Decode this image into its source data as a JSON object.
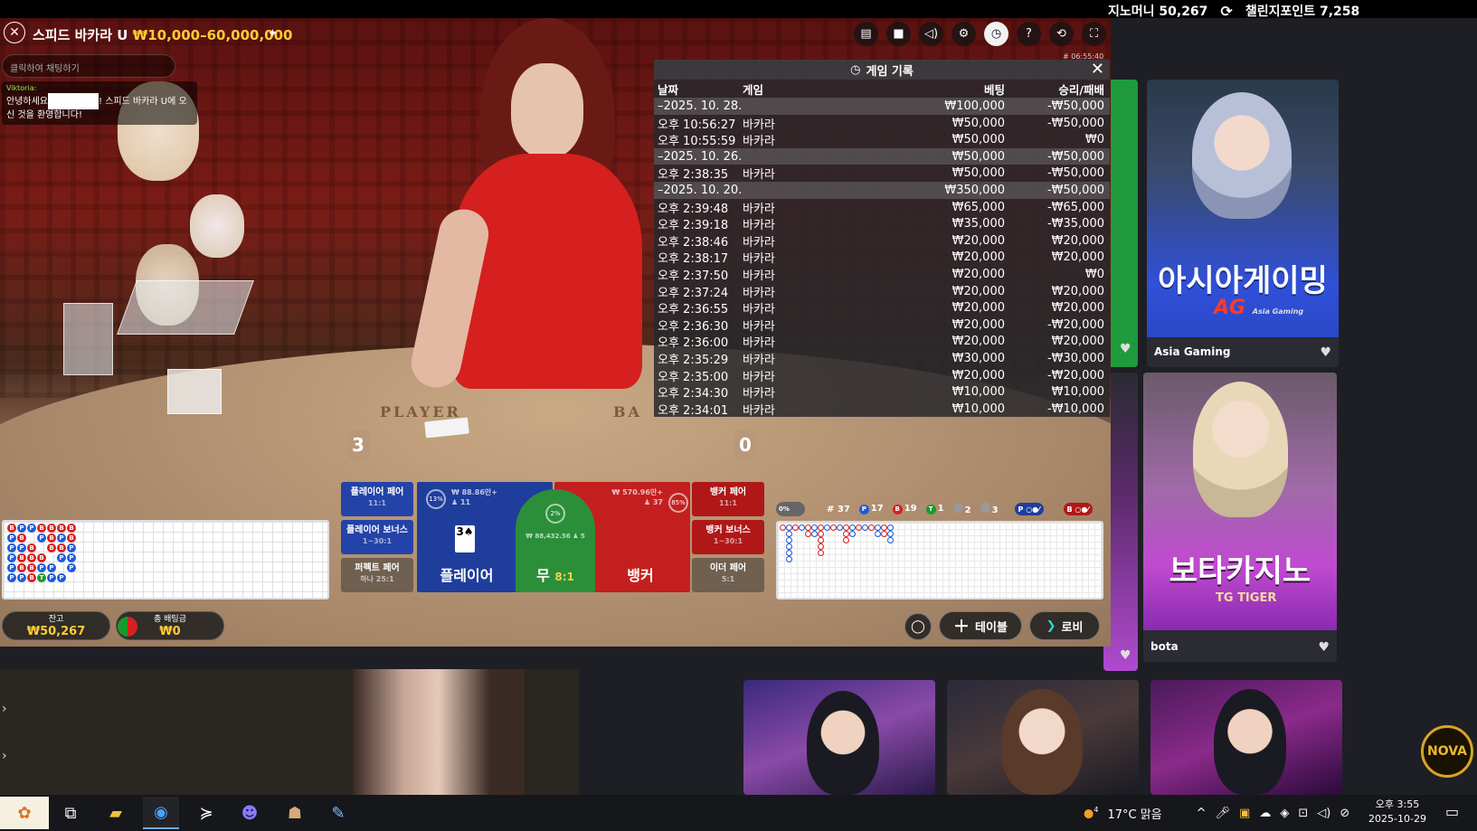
{
  "top": {
    "game_money": "지노머니 50,267",
    "challenge_points": "챌린지포인트 7,258"
  },
  "game": {
    "title": "스피드 바카라 U",
    "limits": "₩10,000–60,000,000",
    "timestamp": "# 06:55:40",
    "chat_placeholder": "클릭하여 채팅하기",
    "chat_user": "Viktoria:",
    "chat_text_start": "안녕하세요",
    "chat_text_end": "! 스피드 바카라 U에 오신 것을 환영합니다!",
    "table_player": "PLAYER",
    "table_banker": "BA",
    "score_player": "3",
    "score_banker": "0"
  },
  "history": {
    "title": "게임 기록",
    "columns": [
      "날짜",
      "게임",
      "베팅",
      "승리/패배"
    ],
    "rows": [
      {
        "type": "date",
        "date": "–2025. 10. 28.",
        "bet": "₩100,000",
        "result": "-₩50,000"
      },
      {
        "type": "row",
        "time": "오후 10:56:27",
        "game": "바카라",
        "bet": "₩50,000",
        "result": "-₩50,000"
      },
      {
        "type": "row",
        "time": "오후 10:55:59",
        "game": "바카라",
        "bet": "₩50,000",
        "result": "₩0"
      },
      {
        "type": "date",
        "date": "–2025. 10. 26.",
        "bet": "₩50,000",
        "result": "-₩50,000"
      },
      {
        "type": "row",
        "time": "오후 2:38:35",
        "game": "바카라",
        "bet": "₩50,000",
        "result": "-₩50,000"
      },
      {
        "type": "date",
        "date": "–2025. 10. 20.",
        "bet": "₩350,000",
        "result": "-₩50,000"
      },
      {
        "type": "row",
        "time": "오후 2:39:48",
        "game": "바카라",
        "bet": "₩65,000",
        "result": "-₩65,000"
      },
      {
        "type": "row",
        "time": "오후 2:39:18",
        "game": "바카라",
        "bet": "₩35,000",
        "result": "-₩35,000"
      },
      {
        "type": "row",
        "time": "오후 2:38:46",
        "game": "바카라",
        "bet": "₩20,000",
        "result": "₩20,000"
      },
      {
        "type": "row",
        "time": "오후 2:38:17",
        "game": "바카라",
        "bet": "₩20,000",
        "result": "₩20,000"
      },
      {
        "type": "row",
        "time": "오후 2:37:50",
        "game": "바카라",
        "bet": "₩20,000",
        "result": "₩0"
      },
      {
        "type": "row",
        "time": "오후 2:37:24",
        "game": "바카라",
        "bet": "₩20,000",
        "result": "₩20,000"
      },
      {
        "type": "row",
        "time": "오후 2:36:55",
        "game": "바카라",
        "bet": "₩20,000",
        "result": "₩20,000"
      },
      {
        "type": "row",
        "time": "오후 2:36:30",
        "game": "바카라",
        "bet": "₩20,000",
        "result": "-₩20,000"
      },
      {
        "type": "row",
        "time": "오후 2:36:00",
        "game": "바카라",
        "bet": "₩20,000",
        "result": "₩20,000"
      },
      {
        "type": "row",
        "time": "오후 2:35:29",
        "game": "바카라",
        "bet": "₩30,000",
        "result": "-₩30,000"
      },
      {
        "type": "row",
        "time": "오후 2:35:00",
        "game": "바카라",
        "bet": "₩20,000",
        "result": "-₩20,000"
      },
      {
        "type": "row",
        "time": "오후 2:34:30",
        "game": "바카라",
        "bet": "₩10,000",
        "result": "₩10,000"
      },
      {
        "type": "row",
        "time": "오후 2:34:01",
        "game": "바카라",
        "bet": "₩10,000",
        "result": "-₩10,000"
      }
    ]
  },
  "bets": {
    "player_pair": "플레이어 페어",
    "player_pair_odds": "11:1",
    "player_bonus": "플레이어 보너스",
    "player_bonus_odds": "1~30:1",
    "perfect_pair": "퍼펙트 페어",
    "perfect_pair_odds": "하나 25:1",
    "banker_pair": "뱅커 페어",
    "banker_pair_odds": "11:1",
    "banker_bonus": "뱅커 보너스",
    "banker_bonus_odds": "1~30:1",
    "either_pair": "이더 페어",
    "either_pair_odds": "5:1",
    "player": "플레이어",
    "player_pct": "13%",
    "player_amount": "₩ 88.86만+",
    "player_count": "♟ 11",
    "player_card": "3♠",
    "tie": "무",
    "tie_odds": "8:1",
    "tie_pct": "2%",
    "tie_amount": "₩ 88,432.56 ♟ 5",
    "banker": "뱅커",
    "banker_pct": "85%",
    "banker_amount": "₩ 570.96만+",
    "banker_count": "♟ 37"
  },
  "stats": {
    "toggle": "0%",
    "total": "# 37",
    "p": "17",
    "b": "19",
    "t": "1",
    "pp": "2",
    "bp": "3",
    "p_label": "P",
    "b_label": "B",
    "t_label": "T"
  },
  "beads": [
    "B",
    "P",
    "P",
    "P",
    "P",
    "P",
    "P",
    "B",
    "P",
    "B",
    "B",
    "P",
    "P",
    "",
    "B",
    "B",
    "B",
    "B",
    "B",
    "P",
    "",
    "B",
    "P",
    "T",
    "B",
    "B",
    "B",
    "",
    "P",
    "P",
    "B",
    "P",
    "B",
    "P",
    "",
    "P",
    "B",
    "B",
    "P",
    "P",
    "P",
    ""
  ],
  "balance": {
    "label": "잔고",
    "value": "₩50,267"
  },
  "total_bet": {
    "label": "총 배팅금",
    "value": "₩0"
  },
  "controls": {
    "table": "테이블",
    "lobby": "로비"
  },
  "lobby": {
    "tile1_label": "Asia Gaming",
    "tile1_text": "아시아게이밍",
    "tile1_logo": "AG",
    "tile1_logo_sub": "Asia Gaming",
    "tile2_label": "bota",
    "tile2_text": "보타카지노",
    "tile2_logo": "TG TIGER"
  },
  "nova": "NOVA",
  "taskbar": {
    "weather": "17°C 맑음",
    "time": "오후 3:55",
    "date": "2025-10-29",
    "notif": "4"
  }
}
